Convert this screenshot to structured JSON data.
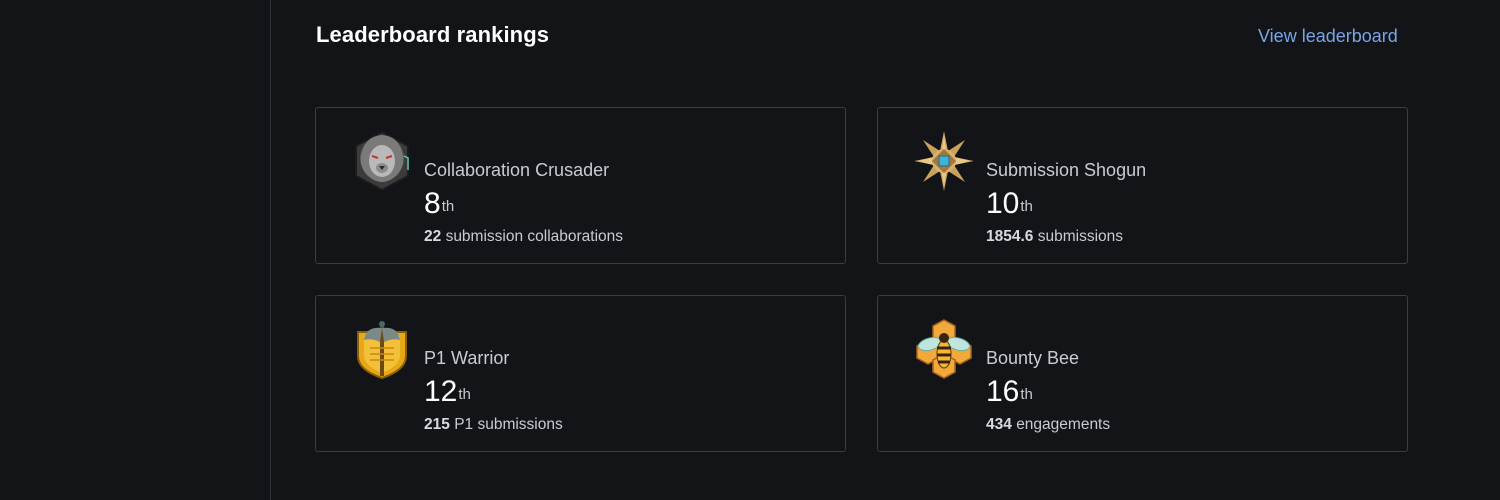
{
  "header": {
    "title": "Leaderboard rankings",
    "view_link": "View leaderboard"
  },
  "cards": [
    {
      "title": "Collaboration Crusader",
      "rank": "8",
      "suffix": "th",
      "count": "22",
      "label": "submission collaborations",
      "icon": "lion-badge-icon"
    },
    {
      "title": "Submission Shogun",
      "rank": "10",
      "suffix": "th",
      "count": "1854.6",
      "label": "submissions",
      "icon": "compass-star-badge-icon"
    },
    {
      "title": "P1 Warrior",
      "rank": "12",
      "suffix": "th",
      "count": "215",
      "label": "P1 submissions",
      "icon": "axe-shield-badge-icon"
    },
    {
      "title": "Bounty Bee",
      "rank": "16",
      "suffix": "th",
      "count": "434",
      "label": "engagements",
      "icon": "bee-honeycomb-badge-icon"
    }
  ],
  "colors": {
    "background": "#121418",
    "card_border": "#3a3d44",
    "link": "#79a6e6",
    "text_primary": "#ffffff",
    "text_secondary": "#c8cbd1"
  }
}
